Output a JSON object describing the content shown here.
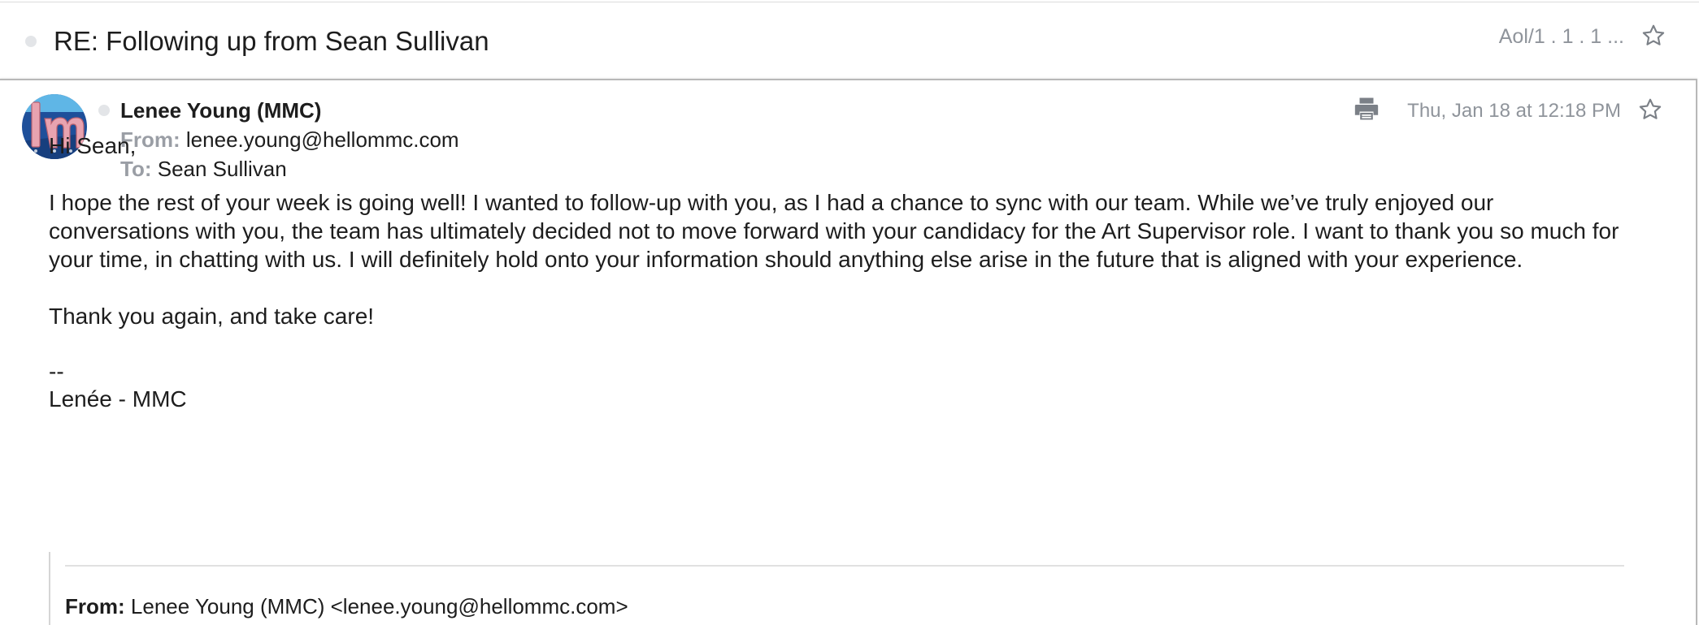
{
  "thread": {
    "subject": "RE: Following up from Sean Sullivan",
    "folder": "Aol/1 . 1 . 1 ..."
  },
  "message": {
    "sender_name": "Lenee Young (MMC)",
    "from_label": "From:",
    "from_address": "lenee.young@hellommc.com",
    "to_label": "To:",
    "to_name": "Sean Sullivan",
    "date": "Thu, Jan 18 at 12:18 PM",
    "avatar_text": "lm"
  },
  "body": {
    "greeting": "Hi Sean,",
    "paragraph": "I hope the rest of your week is going well!  I wanted to follow-up with you, as I had a chance to sync with our team.  While we’ve truly enjoyed our conversations with you, the team has ultimately decided not to move forward with your candidacy for the Art Supervisor role.  I want to thank you so much for your time, in chatting with us.  I will definitely hold onto your information should anything else arise in the future that is aligned with your experience.",
    "closing": "Thank you again, and take care!",
    "sig_dash": "--",
    "sig_name": "Lenée - MMC"
  },
  "quoted": {
    "from_label": "From:",
    "from_value": "Lenee Young (MMC) <lenee.young@hellommc.com>"
  },
  "icons": {
    "star": "star-outline-icon",
    "print": "printer-icon"
  },
  "colors": {
    "muted": "#8f949b",
    "label": "#9a9ea5",
    "avatar_bg": "#1e4f9a",
    "avatar_text": "#e8a3b0"
  }
}
